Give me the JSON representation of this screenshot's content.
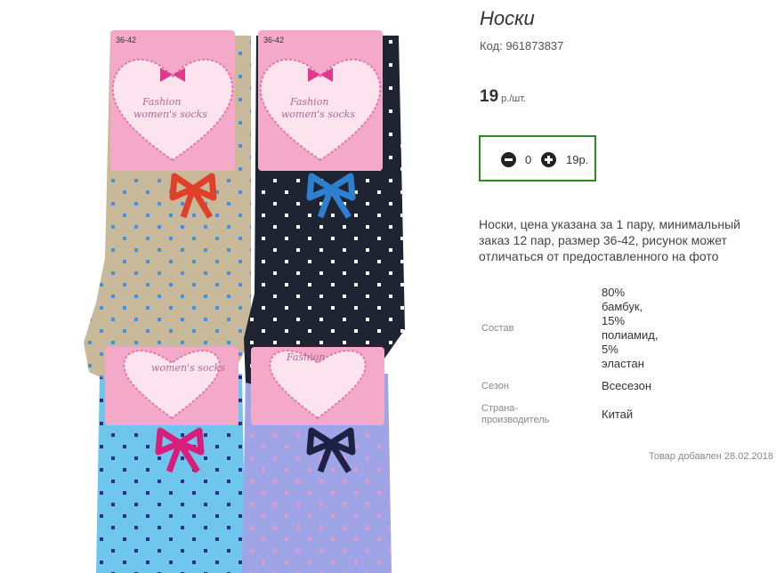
{
  "product": {
    "title": "Носки",
    "code": "Код: 961873837",
    "price": "19",
    "price_unit": "р./шт.",
    "quantity": "0",
    "sum": "19р.",
    "description": "Носки, цена указана за 1 пару, минимальный заказ 12 пар, размер 36-42, рисунок может отличаться от предоставленного на фото",
    "added": "Товар добавлен 28.02.2018"
  },
  "properties": [
    {
      "key": "Состав",
      "value_lines": [
        "80%",
        "бамбук,",
        "15%",
        "полиамид,",
        "5%",
        "эластан"
      ]
    },
    {
      "key": "Сезон",
      "value": "Всесезон"
    },
    {
      "key_lines": [
        "Страна-",
        "производитель"
      ],
      "value": "Китай"
    }
  ],
  "photo": {
    "size_label": "36-42",
    "brand_line1": "Fashion",
    "brand_line2": "women's socks",
    "colors": {
      "beige": "#c8b99a",
      "navy": "#1f2433",
      "sky": "#6ec6ec",
      "lavender": "#9fa4e6",
      "label_pink": "#f4a9c9",
      "heart": "#f7c9dd"
    }
  },
  "colors": {
    "accent_border": "#2e8b22"
  }
}
